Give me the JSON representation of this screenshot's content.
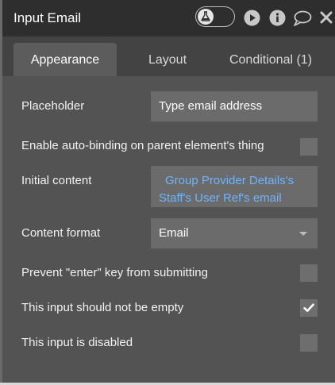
{
  "header": {
    "title": "Input Email",
    "icons": [
      "flask-icon",
      "play-icon",
      "info-icon",
      "comment-icon",
      "close-icon"
    ]
  },
  "tabs": [
    {
      "label": "Appearance",
      "active": true
    },
    {
      "label": "Layout",
      "active": false
    },
    {
      "label": "Conditional (1)",
      "active": false
    }
  ],
  "fields": {
    "placeholder": {
      "label": "Placeholder",
      "value": "Type email address"
    },
    "auto_binding": {
      "label": "Enable auto-binding on parent element's thing",
      "checked": false
    },
    "initial_content": {
      "label": "Initial content",
      "line1": "Group Provider Details's",
      "line2": "Staff's User Ref's email"
    },
    "content_format": {
      "label": "Content format",
      "value": "Email"
    },
    "prevent_enter": {
      "label": "Prevent \"enter\" key from submitting",
      "checked": false
    },
    "not_empty": {
      "label": "This input should not be empty",
      "checked": true
    },
    "disabled": {
      "label": "This input is disabled",
      "checked": false
    }
  },
  "colors": {
    "panel_bg": "#535353",
    "header_bg": "#2e2e2e",
    "field_bg": "#6b6b6b",
    "dynamic_text": "#6cb4ff"
  }
}
